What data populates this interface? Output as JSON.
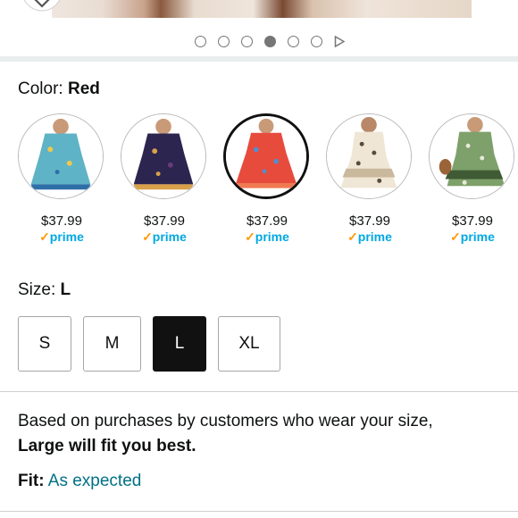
{
  "header": {
    "carousel": {
      "count": 6,
      "active_index": 3
    }
  },
  "color": {
    "label": "Color:",
    "value": "Red",
    "swatches": [
      {
        "name": "blue-floral",
        "price": "$37.99",
        "prime": "prime",
        "selected": false,
        "colors": [
          "#5fb3c6",
          "#2e6fa8",
          "#f0c94a"
        ]
      },
      {
        "name": "navy-floral",
        "price": "$37.99",
        "prime": "prime",
        "selected": false,
        "colors": [
          "#2b2550",
          "#6a3a7a",
          "#d9a04a"
        ]
      },
      {
        "name": "red-floral",
        "price": "$37.99",
        "prime": "prime",
        "selected": true,
        "colors": [
          "#e74b3c",
          "#f07a52",
          "#4f8fd0"
        ]
      },
      {
        "name": "leopard",
        "price": "$37.99",
        "prime": "prime",
        "selected": false,
        "colors": [
          "#efe6d6",
          "#5a4a3a",
          "#c9b89c"
        ]
      },
      {
        "name": "green-floral",
        "price": "$37.99",
        "prime": "prime",
        "selected": false,
        "colors": [
          "#7ea06a",
          "#e8ead8",
          "#3f5a34"
        ]
      }
    ]
  },
  "size": {
    "label": "Size:",
    "value": "L",
    "options": [
      {
        "label": "S",
        "selected": false
      },
      {
        "label": "M",
        "selected": false
      },
      {
        "label": "L",
        "selected": true
      },
      {
        "label": "XL",
        "selected": false
      }
    ]
  },
  "fit_recommendation": {
    "line1": "Based on purchases by customers who wear your size,",
    "line2": "Large will fit you best."
  },
  "fit": {
    "label": "Fit:",
    "value": "As expected"
  }
}
